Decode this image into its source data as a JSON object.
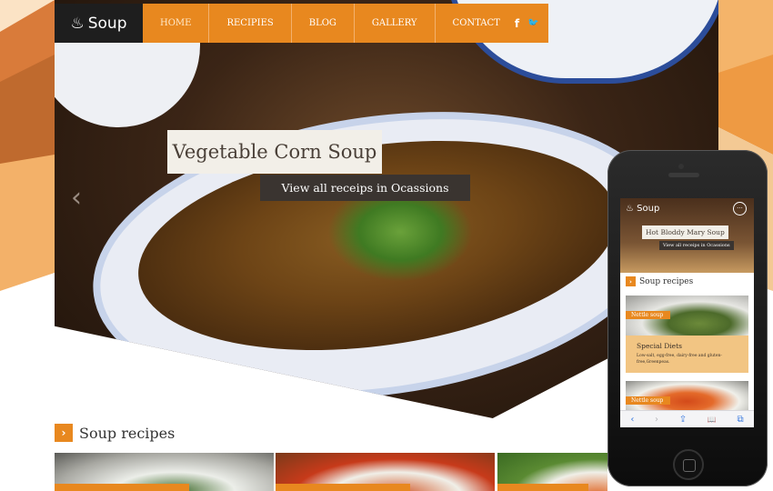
{
  "brand": {
    "logo_text": "Soup",
    "accent": "#e8881f"
  },
  "nav": {
    "items": [
      "HOME",
      "RECIPIES",
      "BLOG",
      "GALLERY",
      "CONTACT"
    ],
    "social": [
      "f",
      "🐦"
    ]
  },
  "slider": {
    "title": "Vegetable Corn Soup",
    "subtitle": "View all receips in Ocassions",
    "prev": "‹"
  },
  "section": {
    "title": "Soup recipes",
    "arrow": "›"
  },
  "mobile": {
    "logo_text": "Soup",
    "menu_icon": "···",
    "slide_title": "Hot Bloddy Mary Soup",
    "slide_subtitle": "View all receips in Ocassions",
    "section_title": "Soup recipes",
    "cards": [
      {
        "tag": "Nettle soup",
        "heading": "Special Diets",
        "text": "Low-salt, egg-free, dairy-free and gluten-free,Greenpeas."
      },
      {
        "tag": "Nettle soup"
      }
    ],
    "toolbar": [
      "‹",
      "›",
      "⇪",
      "📖",
      "⧉"
    ]
  }
}
